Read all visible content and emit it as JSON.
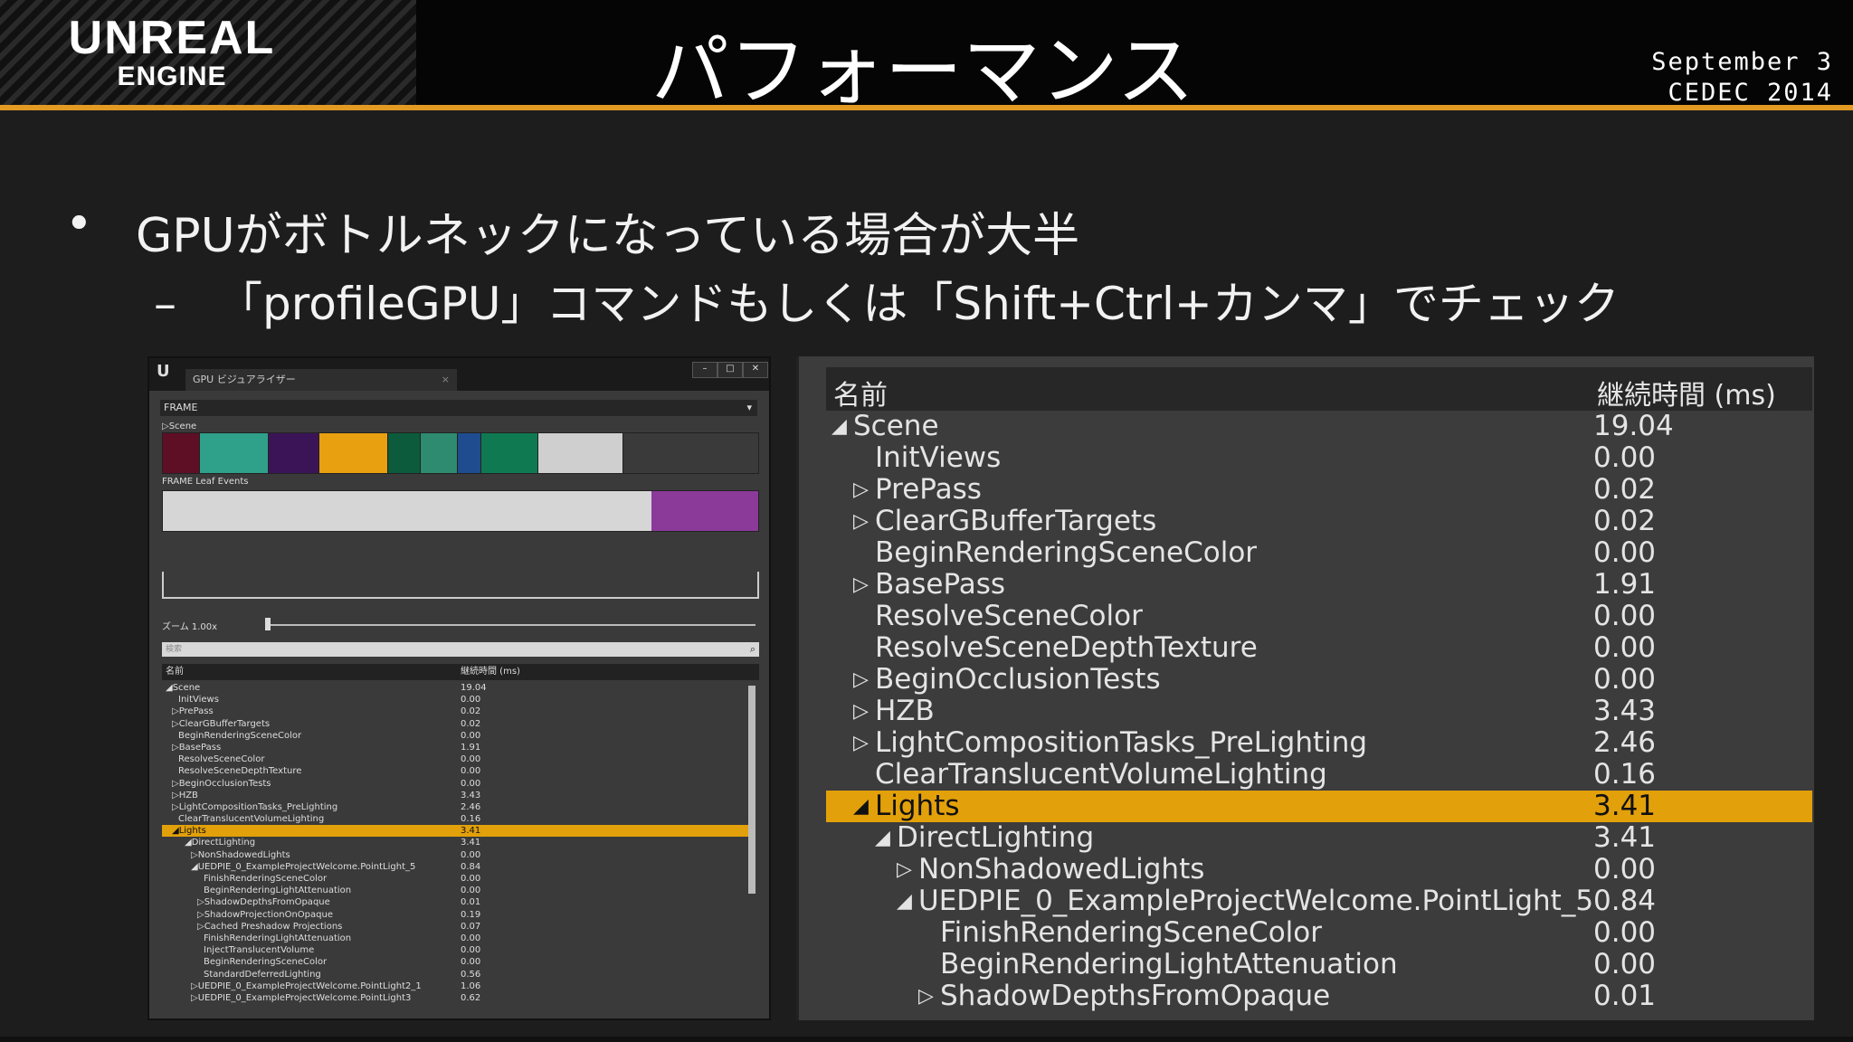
{
  "header": {
    "logo_line1": "UNREAL",
    "logo_line2": "ENGINE",
    "title": "パフォーマンス",
    "date_line1": "September 3",
    "date_line2": "CEDEC 2014"
  },
  "bullets": {
    "main": "GPUがボトルネックになっている場合が大半",
    "sub": "「profileGPU」コマンドもしくは「Shift+Ctrl+カンマ」でチェック",
    "dot": "•",
    "dash": "–"
  },
  "window": {
    "tab_title": "GPU ビジュアライザー",
    "ue_logo": "U",
    "frame_select": "FRAME",
    "scene_label": "▷Scene",
    "leaf_label": "FRAME Leaf Events",
    "zoom_label": "ズーム 1.00x",
    "search_placeholder": "検索",
    "col_name": "名前",
    "col_time": "継続時間 (ms)",
    "scene_bar_colors": [
      "#5e0f26",
      "#2fa08a",
      "#3b1458",
      "#e8a010",
      "#0c5b3c",
      "#2e8b6f",
      "#1f4b8f",
      "#0f7a52",
      "#cfcfcf"
    ],
    "leaf_bar_colors": [
      "#d6d6d6",
      "#8b3a9a"
    ],
    "rows": [
      {
        "name": "◢Scene",
        "value": "19.04",
        "indent": 0
      },
      {
        "name": "InitViews",
        "value": "0.00",
        "indent": 2
      },
      {
        "name": "▷PrePass",
        "value": "0.02",
        "indent": 1
      },
      {
        "name": "▷ClearGBufferTargets",
        "value": "0.02",
        "indent": 1
      },
      {
        "name": "BeginRenderingSceneColor",
        "value": "0.00",
        "indent": 2
      },
      {
        "name": "▷BasePass",
        "value": "1.91",
        "indent": 1
      },
      {
        "name": "ResolveSceneColor",
        "value": "0.00",
        "indent": 2
      },
      {
        "name": "ResolveSceneDepthTexture",
        "value": "0.00",
        "indent": 2
      },
      {
        "name": "▷BeginOcclusionTests",
        "value": "0.00",
        "indent": 1
      },
      {
        "name": "▷HZB",
        "value": "3.43",
        "indent": 1
      },
      {
        "name": "▷LightCompositionTasks_PreLighting",
        "value": "2.46",
        "indent": 1
      },
      {
        "name": "ClearTranslucentVolumeLighting",
        "value": "0.16",
        "indent": 2
      },
      {
        "name": "◢Lights",
        "value": "3.41",
        "indent": 1,
        "selected": true
      },
      {
        "name": "◢DirectLighting",
        "value": "3.41",
        "indent": 3
      },
      {
        "name": "▷NonShadowedLights",
        "value": "0.00",
        "indent": 4
      },
      {
        "name": "◢UEDPIE_0_ExampleProjectWelcome.PointLight_5",
        "value": "0.84",
        "indent": 4
      },
      {
        "name": "FinishRenderingSceneColor",
        "value": "0.00",
        "indent": 6
      },
      {
        "name": "BeginRenderingLightAttenuation",
        "value": "0.00",
        "indent": 6
      },
      {
        "name": "▷ShadowDepthsFromOpaque",
        "value": "0.01",
        "indent": 5
      },
      {
        "name": "▷ShadowProjectionOnOpaque",
        "value": "0.19",
        "indent": 5
      },
      {
        "name": "▷Cached Preshadow Projections",
        "value": "0.07",
        "indent": 5
      },
      {
        "name": "FinishRenderingLightAttenuation",
        "value": "0.00",
        "indent": 6
      },
      {
        "name": "InjectTranslucentVolume",
        "value": "0.00",
        "indent": 6
      },
      {
        "name": "BeginRenderingSceneColor",
        "value": "0.00",
        "indent": 6
      },
      {
        "name": "StandardDeferredLighting",
        "value": "0.56",
        "indent": 6
      },
      {
        "name": "▷UEDPIE_0_ExampleProjectWelcome.PointLight2_1",
        "value": "1.06",
        "indent": 4
      },
      {
        "name": "▷UEDPIE_0_ExampleProjectWelcome.PointLight3",
        "value": "0.62",
        "indent": 4
      }
    ]
  },
  "zoomed": {
    "col_name": "名前",
    "col_time": "継続時間 (ms)",
    "rows": [
      {
        "arrow": "◢",
        "name": "Scene",
        "value": "19.04",
        "indent": 0
      },
      {
        "arrow": "",
        "name": "InitViews",
        "value": "0.00",
        "indent": 1
      },
      {
        "arrow": "▷",
        "name": "PrePass",
        "value": "0.02",
        "indent": 1
      },
      {
        "arrow": "▷",
        "name": "ClearGBufferTargets",
        "value": "0.02",
        "indent": 1
      },
      {
        "arrow": "",
        "name": "BeginRenderingSceneColor",
        "value": "0.00",
        "indent": 1
      },
      {
        "arrow": "▷",
        "name": "BasePass",
        "value": "1.91",
        "indent": 1
      },
      {
        "arrow": "",
        "name": "ResolveSceneColor",
        "value": "0.00",
        "indent": 1
      },
      {
        "arrow": "",
        "name": "ResolveSceneDepthTexture",
        "value": "0.00",
        "indent": 1
      },
      {
        "arrow": "▷",
        "name": "BeginOcclusionTests",
        "value": "0.00",
        "indent": 1
      },
      {
        "arrow": "▷",
        "name": "HZB",
        "value": "3.43",
        "indent": 1
      },
      {
        "arrow": "▷",
        "name": "LightCompositionTasks_PreLighting",
        "value": "2.46",
        "indent": 1
      },
      {
        "arrow": "",
        "name": "ClearTranslucentVolumeLighting",
        "value": "0.16",
        "indent": 1
      },
      {
        "arrow": "◢",
        "name": "Lights",
        "value": "3.41",
        "indent": 1,
        "selected": true
      },
      {
        "arrow": "◢",
        "name": "DirectLighting",
        "value": "3.41",
        "indent": 2
      },
      {
        "arrow": "▷",
        "name": "NonShadowedLights",
        "value": "0.00",
        "indent": 3
      },
      {
        "arrow": "◢",
        "name": "UEDPIE_0_ExampleProjectWelcome.PointLight_5",
        "value": "0.84",
        "indent": 3
      },
      {
        "arrow": "",
        "name": "FinishRenderingSceneColor",
        "value": "0.00",
        "indent": 4
      },
      {
        "arrow": "",
        "name": "BeginRenderingLightAttenuation",
        "value": "0.00",
        "indent": 4
      },
      {
        "arrow": "▷",
        "name": "ShadowDepthsFromOpaque",
        "value": "0.01",
        "indent": 4
      }
    ]
  }
}
